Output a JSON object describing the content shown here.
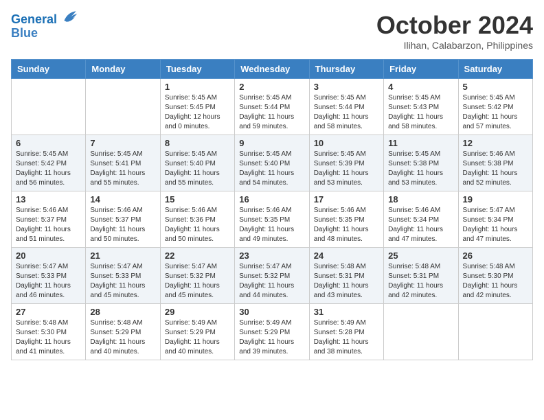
{
  "logo": {
    "line1": "General",
    "line2": "Blue"
  },
  "title": "October 2024",
  "location": "Ilihan, Calabarzon, Philippines",
  "weekdays": [
    "Sunday",
    "Monday",
    "Tuesday",
    "Wednesday",
    "Thursday",
    "Friday",
    "Saturday"
  ],
  "weeks": [
    [
      {
        "day": "",
        "info": ""
      },
      {
        "day": "",
        "info": ""
      },
      {
        "day": "1",
        "info": "Sunrise: 5:45 AM\nSunset: 5:45 PM\nDaylight: 12 hours\nand 0 minutes."
      },
      {
        "day": "2",
        "info": "Sunrise: 5:45 AM\nSunset: 5:44 PM\nDaylight: 11 hours\nand 59 minutes."
      },
      {
        "day": "3",
        "info": "Sunrise: 5:45 AM\nSunset: 5:44 PM\nDaylight: 11 hours\nand 58 minutes."
      },
      {
        "day": "4",
        "info": "Sunrise: 5:45 AM\nSunset: 5:43 PM\nDaylight: 11 hours\nand 58 minutes."
      },
      {
        "day": "5",
        "info": "Sunrise: 5:45 AM\nSunset: 5:42 PM\nDaylight: 11 hours\nand 57 minutes."
      }
    ],
    [
      {
        "day": "6",
        "info": "Sunrise: 5:45 AM\nSunset: 5:42 PM\nDaylight: 11 hours\nand 56 minutes."
      },
      {
        "day": "7",
        "info": "Sunrise: 5:45 AM\nSunset: 5:41 PM\nDaylight: 11 hours\nand 55 minutes."
      },
      {
        "day": "8",
        "info": "Sunrise: 5:45 AM\nSunset: 5:40 PM\nDaylight: 11 hours\nand 55 minutes."
      },
      {
        "day": "9",
        "info": "Sunrise: 5:45 AM\nSunset: 5:40 PM\nDaylight: 11 hours\nand 54 minutes."
      },
      {
        "day": "10",
        "info": "Sunrise: 5:45 AM\nSunset: 5:39 PM\nDaylight: 11 hours\nand 53 minutes."
      },
      {
        "day": "11",
        "info": "Sunrise: 5:45 AM\nSunset: 5:38 PM\nDaylight: 11 hours\nand 53 minutes."
      },
      {
        "day": "12",
        "info": "Sunrise: 5:46 AM\nSunset: 5:38 PM\nDaylight: 11 hours\nand 52 minutes."
      }
    ],
    [
      {
        "day": "13",
        "info": "Sunrise: 5:46 AM\nSunset: 5:37 PM\nDaylight: 11 hours\nand 51 minutes."
      },
      {
        "day": "14",
        "info": "Sunrise: 5:46 AM\nSunset: 5:37 PM\nDaylight: 11 hours\nand 50 minutes."
      },
      {
        "day": "15",
        "info": "Sunrise: 5:46 AM\nSunset: 5:36 PM\nDaylight: 11 hours\nand 50 minutes."
      },
      {
        "day": "16",
        "info": "Sunrise: 5:46 AM\nSunset: 5:35 PM\nDaylight: 11 hours\nand 49 minutes."
      },
      {
        "day": "17",
        "info": "Sunrise: 5:46 AM\nSunset: 5:35 PM\nDaylight: 11 hours\nand 48 minutes."
      },
      {
        "day": "18",
        "info": "Sunrise: 5:46 AM\nSunset: 5:34 PM\nDaylight: 11 hours\nand 47 minutes."
      },
      {
        "day": "19",
        "info": "Sunrise: 5:47 AM\nSunset: 5:34 PM\nDaylight: 11 hours\nand 47 minutes."
      }
    ],
    [
      {
        "day": "20",
        "info": "Sunrise: 5:47 AM\nSunset: 5:33 PM\nDaylight: 11 hours\nand 46 minutes."
      },
      {
        "day": "21",
        "info": "Sunrise: 5:47 AM\nSunset: 5:33 PM\nDaylight: 11 hours\nand 45 minutes."
      },
      {
        "day": "22",
        "info": "Sunrise: 5:47 AM\nSunset: 5:32 PM\nDaylight: 11 hours\nand 45 minutes."
      },
      {
        "day": "23",
        "info": "Sunrise: 5:47 AM\nSunset: 5:32 PM\nDaylight: 11 hours\nand 44 minutes."
      },
      {
        "day": "24",
        "info": "Sunrise: 5:48 AM\nSunset: 5:31 PM\nDaylight: 11 hours\nand 43 minutes."
      },
      {
        "day": "25",
        "info": "Sunrise: 5:48 AM\nSunset: 5:31 PM\nDaylight: 11 hours\nand 42 minutes."
      },
      {
        "day": "26",
        "info": "Sunrise: 5:48 AM\nSunset: 5:30 PM\nDaylight: 11 hours\nand 42 minutes."
      }
    ],
    [
      {
        "day": "27",
        "info": "Sunrise: 5:48 AM\nSunset: 5:30 PM\nDaylight: 11 hours\nand 41 minutes."
      },
      {
        "day": "28",
        "info": "Sunrise: 5:48 AM\nSunset: 5:29 PM\nDaylight: 11 hours\nand 40 minutes."
      },
      {
        "day": "29",
        "info": "Sunrise: 5:49 AM\nSunset: 5:29 PM\nDaylight: 11 hours\nand 40 minutes."
      },
      {
        "day": "30",
        "info": "Sunrise: 5:49 AM\nSunset: 5:29 PM\nDaylight: 11 hours\nand 39 minutes."
      },
      {
        "day": "31",
        "info": "Sunrise: 5:49 AM\nSunset: 5:28 PM\nDaylight: 11 hours\nand 38 minutes."
      },
      {
        "day": "",
        "info": ""
      },
      {
        "day": "",
        "info": ""
      }
    ]
  ]
}
